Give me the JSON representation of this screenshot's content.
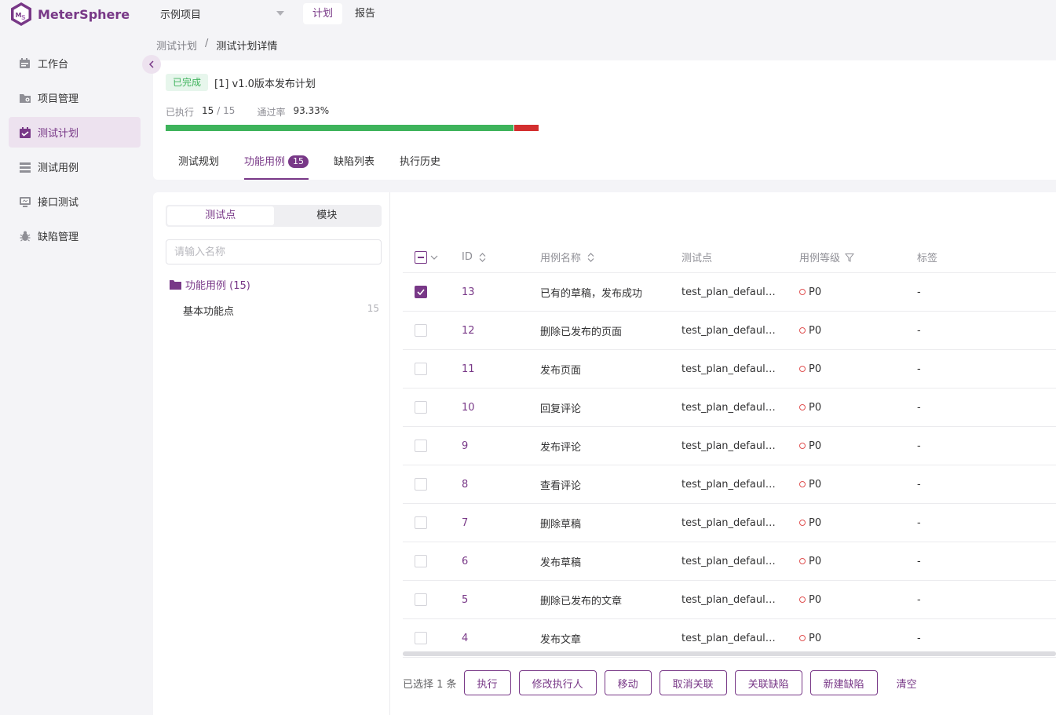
{
  "app": {
    "name": "MeterSphere"
  },
  "topbar": {
    "project": "示例项目",
    "nav": [
      {
        "label": "计划",
        "active": true
      },
      {
        "label": "报告",
        "active": false
      }
    ]
  },
  "sidebar": {
    "items": [
      {
        "label": "工作台",
        "icon": "workbench-icon",
        "active": false
      },
      {
        "label": "项目管理",
        "icon": "project-icon",
        "active": false
      },
      {
        "label": "测试计划",
        "icon": "test-plan-icon",
        "active": true
      },
      {
        "label": "测试用例",
        "icon": "test-case-icon",
        "active": false
      },
      {
        "label": "接口测试",
        "icon": "api-test-icon",
        "active": false
      },
      {
        "label": "缺陷管理",
        "icon": "bug-icon",
        "active": false
      }
    ]
  },
  "breadcrumb": {
    "parent": "测试计划",
    "separator": "/",
    "current": "测试计划详情"
  },
  "plan": {
    "status": "已完成",
    "title": "[1] v1.0版本发布计划",
    "executed_label": "已执行",
    "executed": "15",
    "total_sep": "/ 15",
    "pass_rate_label": "通过率",
    "pass_rate": "93.33%",
    "pass_fraction": 0.9333,
    "colors": {
      "pass": "#3eb35b",
      "fail": "#d32f2f",
      "accent": "#783887"
    }
  },
  "tabs": [
    {
      "label": "测试规划",
      "active": false
    },
    {
      "label": "功能用例",
      "active": true,
      "badge": "15"
    },
    {
      "label": "缺陷列表",
      "active": false
    },
    {
      "label": "执行历史",
      "active": false
    }
  ],
  "left_panel": {
    "segments": [
      {
        "label": "测试点",
        "active": true
      },
      {
        "label": "模块",
        "active": false
      }
    ],
    "search_placeholder": "请输入名称",
    "tree_root": "功能用例 (15)",
    "tree_child": {
      "label": "基本功能点",
      "count": "15"
    }
  },
  "table": {
    "columns": [
      "ID",
      "用例名称",
      "测试点",
      "用例等级",
      "标签"
    ],
    "rows": [
      {
        "id": "13",
        "name": "已有的草稿，发布成功",
        "point": "test_plan_default_...",
        "level": "P0",
        "tag": "-",
        "checked": true
      },
      {
        "id": "12",
        "name": "删除已发布的页面",
        "point": "test_plan_default_...",
        "level": "P0",
        "tag": "-",
        "checked": false
      },
      {
        "id": "11",
        "name": "发布页面",
        "point": "test_plan_default_...",
        "level": "P0",
        "tag": "-",
        "checked": false
      },
      {
        "id": "10",
        "name": "回复评论",
        "point": "test_plan_default_...",
        "level": "P0",
        "tag": "-",
        "checked": false
      },
      {
        "id": "9",
        "name": "发布评论",
        "point": "test_plan_default_...",
        "level": "P0",
        "tag": "-",
        "checked": false
      },
      {
        "id": "8",
        "name": "查看评论",
        "point": "test_plan_default_...",
        "level": "P0",
        "tag": "-",
        "checked": false
      },
      {
        "id": "7",
        "name": "删除草稿",
        "point": "test_plan_default_...",
        "level": "P0",
        "tag": "-",
        "checked": false
      },
      {
        "id": "6",
        "name": "发布草稿",
        "point": "test_plan_default_...",
        "level": "P0",
        "tag": "-",
        "checked": false
      },
      {
        "id": "5",
        "name": "删除已发布的文章",
        "point": "test_plan_default_...",
        "level": "P0",
        "tag": "-",
        "checked": false
      },
      {
        "id": "4",
        "name": "发布文章",
        "point": "test_plan_default_...",
        "level": "P0",
        "tag": "-",
        "checked": false
      }
    ]
  },
  "batch": {
    "selected_text": "已选择 1 条",
    "buttons": [
      "执行",
      "修改执行人",
      "移动",
      "取消关联",
      "关联缺陷",
      "新建缺陷"
    ],
    "clear": "清空"
  }
}
